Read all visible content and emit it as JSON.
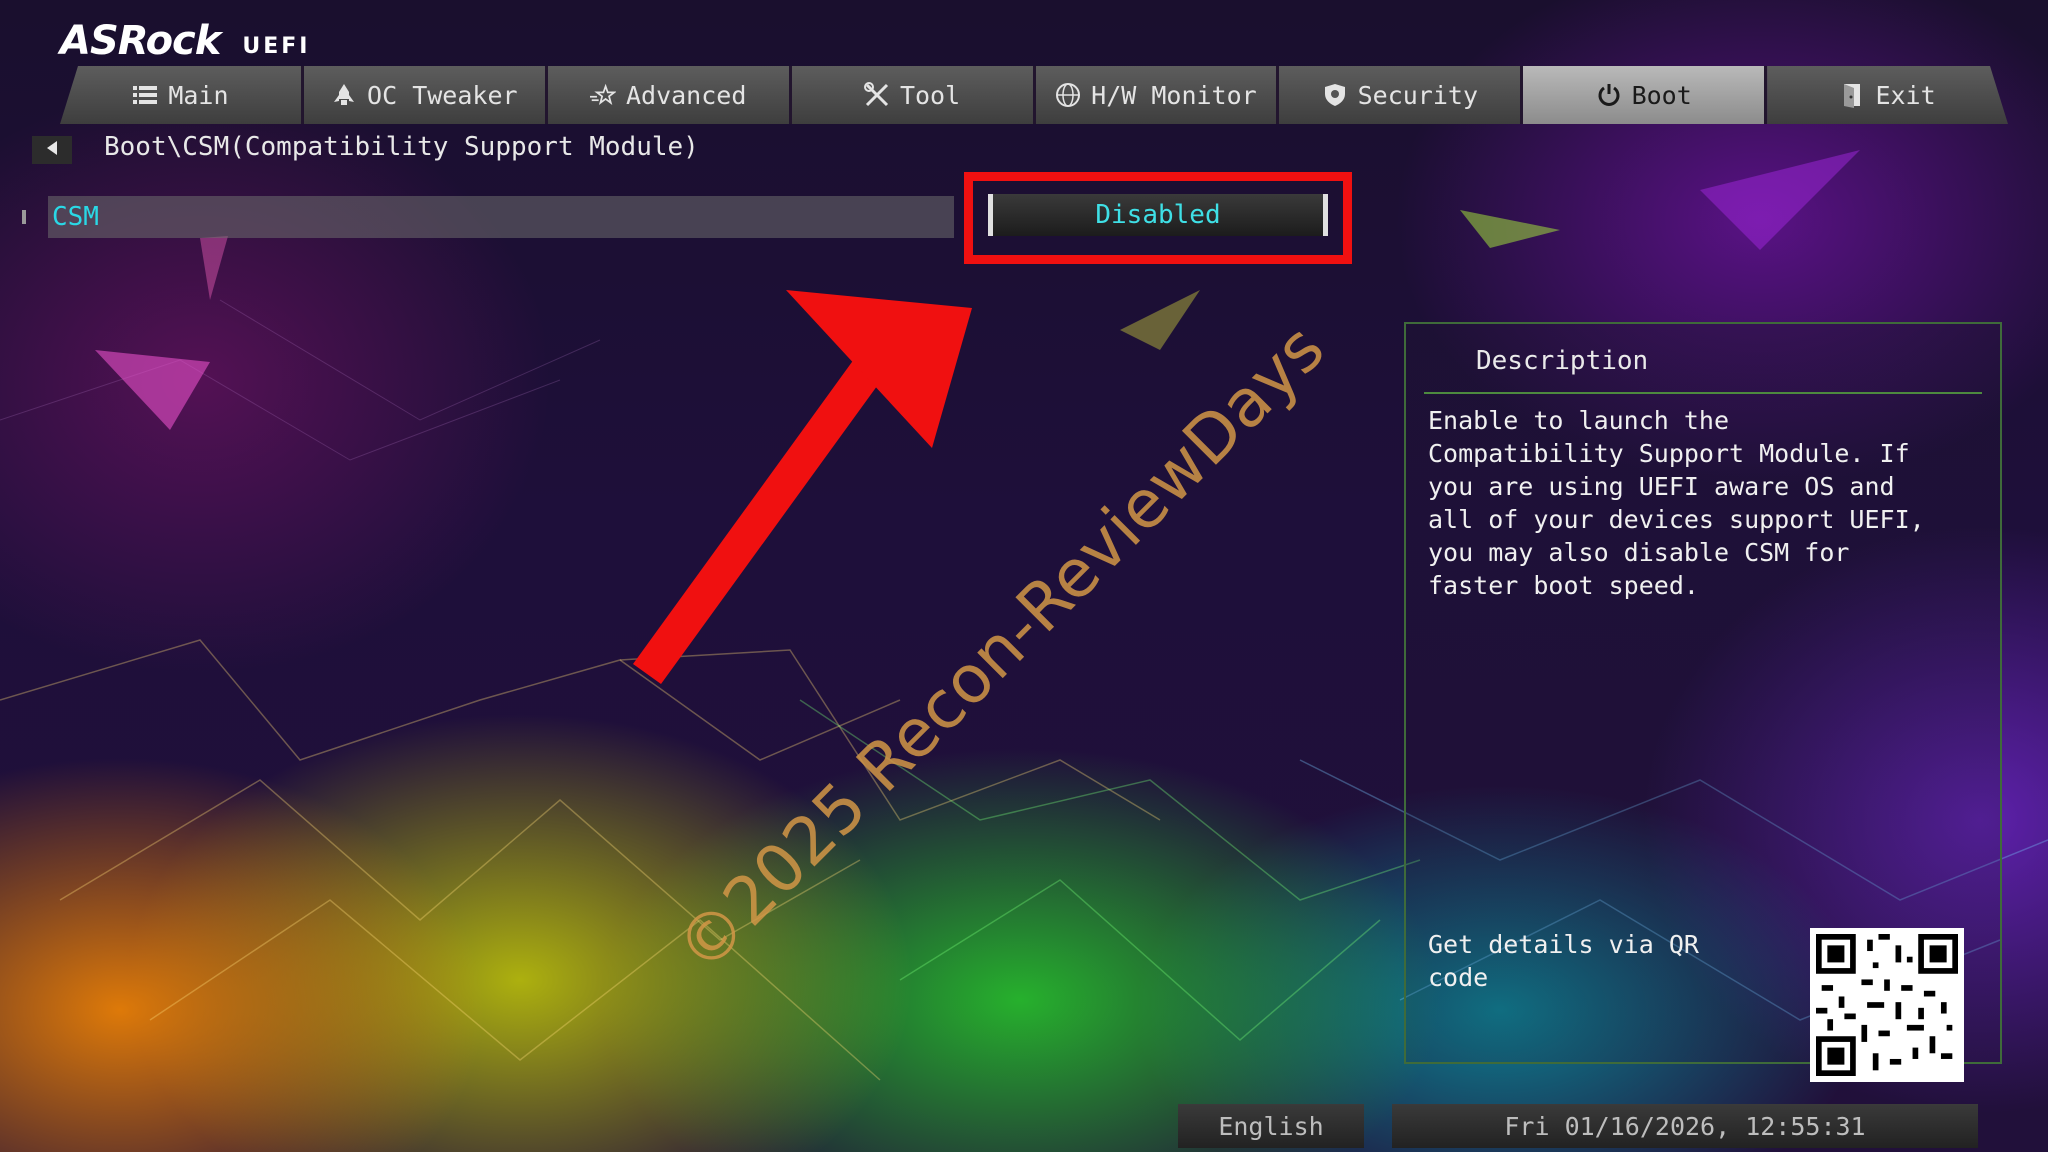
{
  "brand": {
    "logo": "ASRock",
    "suffix": "UEFI"
  },
  "tabs": [
    {
      "label": "Main",
      "icon": "list-icon"
    },
    {
      "label": "OC Tweaker",
      "icon": "rocket-icon"
    },
    {
      "label": "Advanced",
      "icon": "star-icon"
    },
    {
      "label": "Tool",
      "icon": "tools-icon"
    },
    {
      "label": "H/W Monitor",
      "icon": "globe-icon"
    },
    {
      "label": "Security",
      "icon": "shield-icon"
    },
    {
      "label": "Boot",
      "icon": "power-icon"
    },
    {
      "label": "Exit",
      "icon": "exit-door-icon"
    }
  ],
  "active_tab": "Boot",
  "breadcrumb": "Boot\\CSM(Compatibility Support Module)",
  "option": {
    "label": "CSM",
    "value": "Disabled"
  },
  "description": {
    "title": "Description",
    "text": "Enable to launch the\nCompatibility Support Module. If\nyou are using UEFI aware OS and\nall of your devices support UEFI,\nyou may also disable CSM for\nfaster boot speed.",
    "qr_label": "Get details via QR code"
  },
  "footer": {
    "language": "English",
    "datetime": "Fri 01/16/2026, 12:55:31"
  },
  "watermark": "©2025 Recon-ReviewDays",
  "colors": {
    "highlight": "#f01010",
    "arrow": "#f01010",
    "option_text": "#2ad8e6",
    "panel_border": "#3f6b3a"
  }
}
